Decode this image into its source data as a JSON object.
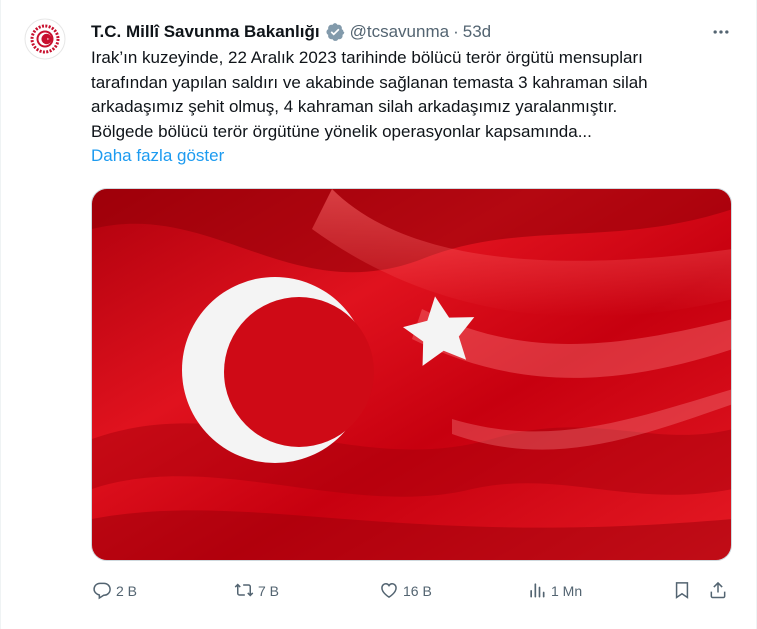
{
  "tweet": {
    "author_name": "T.C. Millî Savunma Bakanlığı",
    "handle": "@tcsavunma",
    "separator": "·",
    "time": "53d",
    "text_lines": [
      "Irak’ın kuzeyinde, 22 Aralık 2023 tarihinde bölücü terör örgütü mensupları",
      "tarafından yapılan saldırı ve akabinde sağlanan temasta 3 kahraman silah",
      "arkadaşımız şehit olmuş, 4 kahraman silah arkadaşımız yaralanmıştır.",
      "Bölgede bölücü terör örgütüne yönelik operasyonlar kapsamında..."
    ],
    "show_more": "Daha fazla göster",
    "media_alt": "Turkish flag",
    "icons": {
      "verified": "verified-badge-icon",
      "more": "more-options-icon",
      "reply": "reply-icon",
      "retweet": "retweet-icon",
      "like": "like-icon",
      "views": "views-icon",
      "bookmark": "bookmark-icon",
      "share": "share-icon"
    }
  },
  "actions": {
    "replies": "2 B",
    "retweets": "7 B",
    "likes": "16 B",
    "views": "1 Mn"
  },
  "colors": {
    "verified_badge": "#829aab",
    "link": "#1d9bf0",
    "muted": "#536471",
    "flag_red": "#e30a17"
  }
}
